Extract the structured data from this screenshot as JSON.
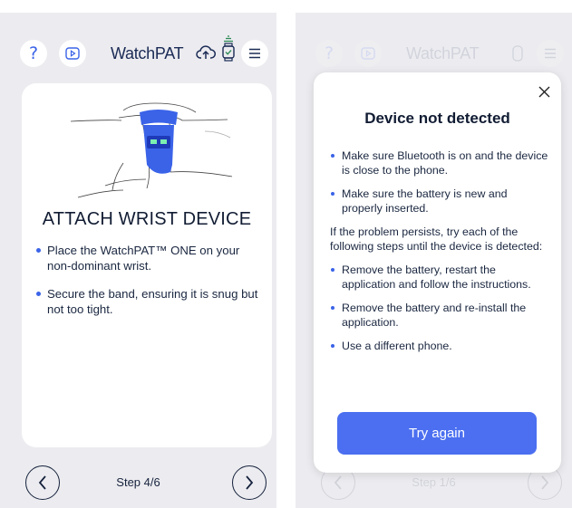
{
  "left_screen": {
    "header": {
      "help_label": "?",
      "brand": "WatchPAT"
    },
    "card": {
      "title": "ATTACH WRIST DEVICE",
      "bullets": [
        "Place the WatchPAT™ ONE on your non-dominant wrist.",
        "Secure the band, ensuring it is snug but not too tight."
      ]
    },
    "footer": {
      "step": "Step 4/6"
    }
  },
  "right_screen": {
    "header": {
      "help_label": "?",
      "brand": "WatchPAT"
    },
    "footer": {
      "step": "Step 1/6"
    },
    "modal": {
      "title": "Device not detected",
      "bullets_top": [
        "Make sure Bluetooth is on and the device is close to the phone.",
        "Make sure the battery is new and properly inserted."
      ],
      "paragraph": "If the problem persists, try each of the following steps until the device is detected:",
      "bullets_bottom": [
        "Remove the battery, restart the application and follow the instructions.",
        "Remove the battery and re-install the application.",
        "Use a different phone."
      ],
      "button": "Try again"
    }
  },
  "colors": {
    "accent": "#3a63e8",
    "button": "#4b6ff0",
    "background": "#ececf0",
    "text": "#14213d"
  },
  "icons": [
    "help-icon",
    "video-icon",
    "cloud-upload-icon",
    "watch-icon",
    "menu-icon",
    "chevron-left-icon",
    "chevron-right-icon",
    "close-icon"
  ]
}
